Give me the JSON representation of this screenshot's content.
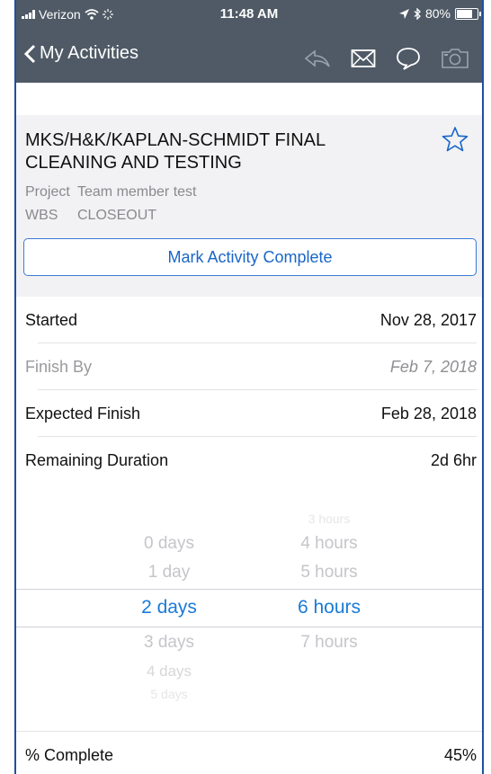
{
  "status_bar": {
    "carrier": "Verizon",
    "time": "11:48 AM",
    "battery": "80%",
    "battery_level": 0.8,
    "icons": [
      "signal-bars-icon",
      "wifi-icon",
      "activity-icon",
      "location-arrow-icon",
      "bluetooth-icon",
      "battery-icon"
    ]
  },
  "nav": {
    "back_label": "My Activities",
    "icons": [
      "chevron-left-icon",
      "reply-icon",
      "mail-icon",
      "chat-bubble-icon",
      "camera-icon"
    ]
  },
  "activity": {
    "title": "MKS/H&K/KAPLAN-SCHMIDT FINAL CLEANING AND TESTING",
    "project_label": "Project",
    "project_value": "Team member test",
    "wbs_label": "WBS",
    "wbs_value": "CLOSEOUT",
    "mark_complete_label": "Mark Activity Complete",
    "star_icon": "star-icon"
  },
  "details": [
    {
      "label": "Started",
      "value": "Nov 28, 2017",
      "muted": false
    },
    {
      "label": "Finish By",
      "value": "Feb 7, 2018",
      "muted": true
    },
    {
      "label": "Expected Finish",
      "value": "Feb 28, 2018",
      "muted": false
    },
    {
      "label": "Remaining Duration",
      "value": "2d 6hr",
      "muted": false
    }
  ],
  "duration_picker": {
    "days": {
      "selected": "2 days",
      "above": [
        "0 days",
        "1 day"
      ],
      "below": [
        "3 days",
        "4 days",
        "5 days"
      ]
    },
    "hours": {
      "selected": "6 hours",
      "above": [
        "3 hours",
        "4 hours",
        "5 hours"
      ],
      "below": [
        "7 hours"
      ]
    }
  },
  "percent_complete": {
    "label": "% Complete",
    "value": "45%"
  },
  "colors": {
    "nav_bg": "#4f5a66",
    "accent": "#1a66c8",
    "card_bg": "#f2f2f4",
    "frame": "#1f4fa0"
  }
}
